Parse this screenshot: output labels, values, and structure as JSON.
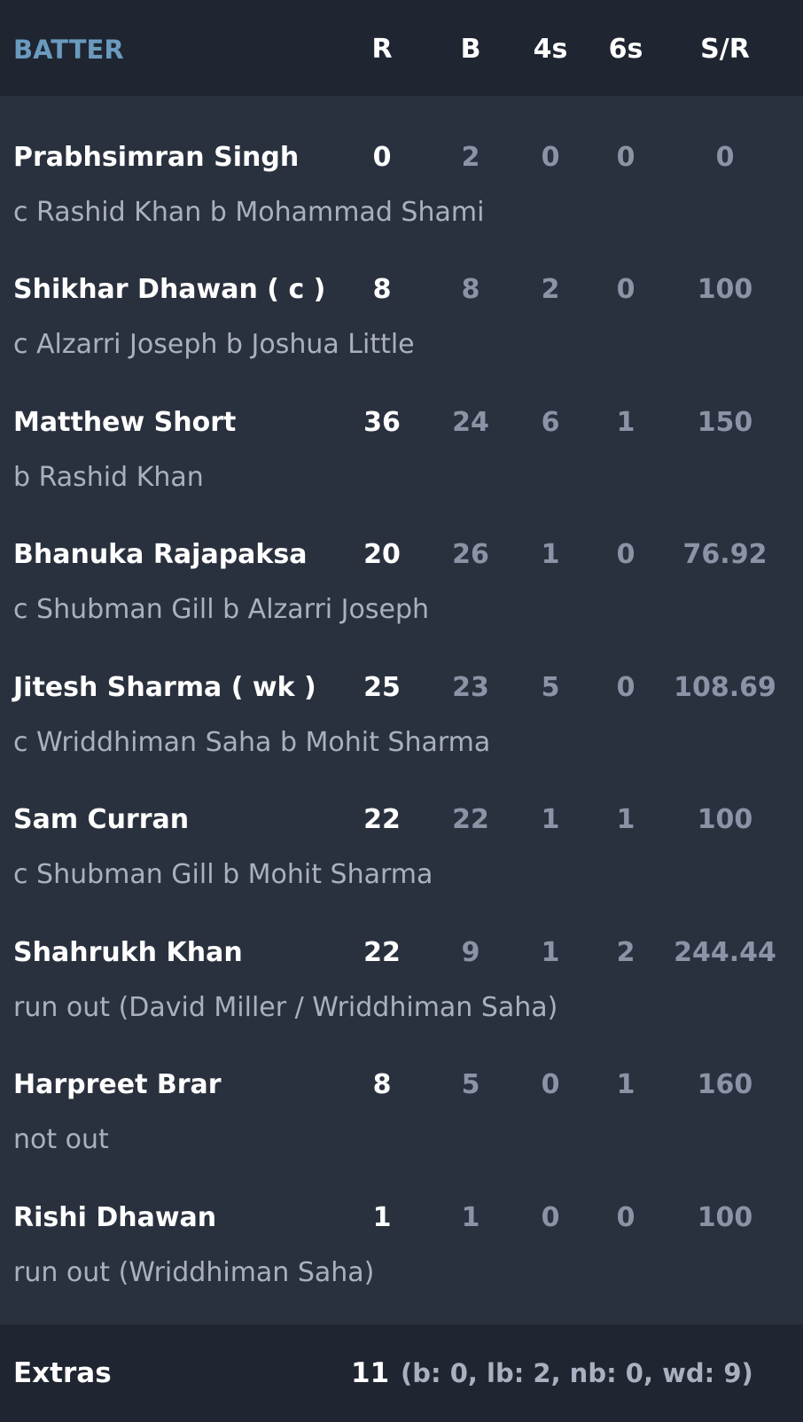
{
  "header": {
    "batter": "BATTER",
    "runs": "R",
    "balls": "B",
    "fours": "4s",
    "sixes": "6s",
    "strike_rate": "S/R"
  },
  "batters": [
    {
      "name": "Prabhsimran Singh",
      "dismissal": "c Rashid Khan b Mohammad Shami",
      "r": "0",
      "b": "2",
      "fours": "0",
      "sixes": "0",
      "sr": "0"
    },
    {
      "name": "Shikhar Dhawan ( c )",
      "dismissal": "c Alzarri Joseph b Joshua Little",
      "r": "8",
      "b": "8",
      "fours": "2",
      "sixes": "0",
      "sr": "100"
    },
    {
      "name": "Matthew Short",
      "dismissal": "b Rashid Khan",
      "r": "36",
      "b": "24",
      "fours": "6",
      "sixes": "1",
      "sr": "150"
    },
    {
      "name": "Bhanuka Rajapaksa",
      "dismissal": "c Shubman Gill b Alzarri Joseph",
      "r": "20",
      "b": "26",
      "fours": "1",
      "sixes": "0",
      "sr": "76.92"
    },
    {
      "name": "Jitesh Sharma ( wk )",
      "dismissal": "c Wriddhiman Saha b Mohit Sharma",
      "r": "25",
      "b": "23",
      "fours": "5",
      "sixes": "0",
      "sr": "108.69"
    },
    {
      "name": "Sam Curran",
      "dismissal": "c Shubman Gill b Mohit Sharma",
      "r": "22",
      "b": "22",
      "fours": "1",
      "sixes": "1",
      "sr": "100"
    },
    {
      "name": "Shahrukh Khan",
      "dismissal": "run out (David Miller / Wriddhiman Saha)",
      "r": "22",
      "b": "9",
      "fours": "1",
      "sixes": "2",
      "sr": "244.44"
    },
    {
      "name": "Harpreet Brar",
      "dismissal": "not out",
      "r": "8",
      "b": "5",
      "fours": "0",
      "sixes": "1",
      "sr": "160"
    },
    {
      "name": "Rishi Dhawan",
      "dismissal": "run out (Wriddhiman Saha)",
      "r": "1",
      "b": "1",
      "fours": "0",
      "sixes": "0",
      "sr": "100"
    }
  ],
  "extras": {
    "label": "Extras",
    "total": "11",
    "detail": "(b: 0, lb: 2, nb: 0, wd: 9)"
  },
  "colors": {
    "background": "#2a313e",
    "header_bg": "#1f2531",
    "accent": "#6a9bbf",
    "primary_text": "#ffffff",
    "secondary_text": "#8b93a6"
  }
}
